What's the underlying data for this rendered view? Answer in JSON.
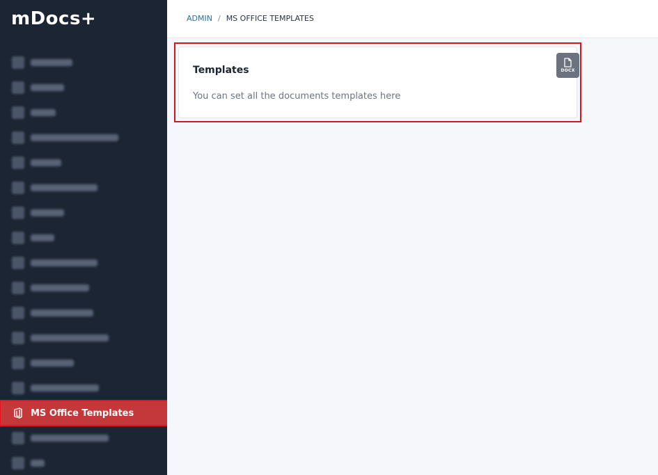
{
  "app": {
    "title": "mDocs+"
  },
  "sidebar": {
    "items": [
      {
        "label": "",
        "blurred": true,
        "width": 60
      },
      {
        "label": "",
        "blurred": true,
        "width": 48
      },
      {
        "label": "",
        "blurred": true,
        "width": 36
      },
      {
        "label": "",
        "blurred": true,
        "width": 126
      },
      {
        "label": "",
        "blurred": true,
        "width": 44
      },
      {
        "label": "",
        "blurred": true,
        "width": 96
      },
      {
        "label": "",
        "blurred": true,
        "width": 48
      },
      {
        "label": "",
        "blurred": true,
        "width": 34
      },
      {
        "label": "",
        "blurred": true,
        "width": 96
      },
      {
        "label": "",
        "blurred": true,
        "width": 84
      },
      {
        "label": "",
        "blurred": true,
        "width": 90
      },
      {
        "label": "",
        "blurred": true,
        "width": 112
      },
      {
        "label": "",
        "blurred": true,
        "width": 62
      },
      {
        "label": "",
        "blurred": true,
        "width": 98
      },
      {
        "label": "MS Office Templates",
        "active": true
      },
      {
        "label": "",
        "blurred": true,
        "width": 112
      },
      {
        "label": "",
        "blurred": true,
        "width": 20
      }
    ],
    "active_label": "MS Office Templates",
    "active_bg": "#c5383a"
  },
  "breadcrumb": {
    "root": "ADMIN",
    "separator": "/",
    "current": "MS OFFICE TEMPLATES"
  },
  "card": {
    "title": "Templates",
    "description": "You can set all the documents templates here",
    "docx_button_label": "DOCX",
    "docx_icon": "file-icon"
  },
  "colors": {
    "sidebar_bg": "#1c2533",
    "highlight_border": "#d5161d",
    "link": "#2a6fa3"
  }
}
